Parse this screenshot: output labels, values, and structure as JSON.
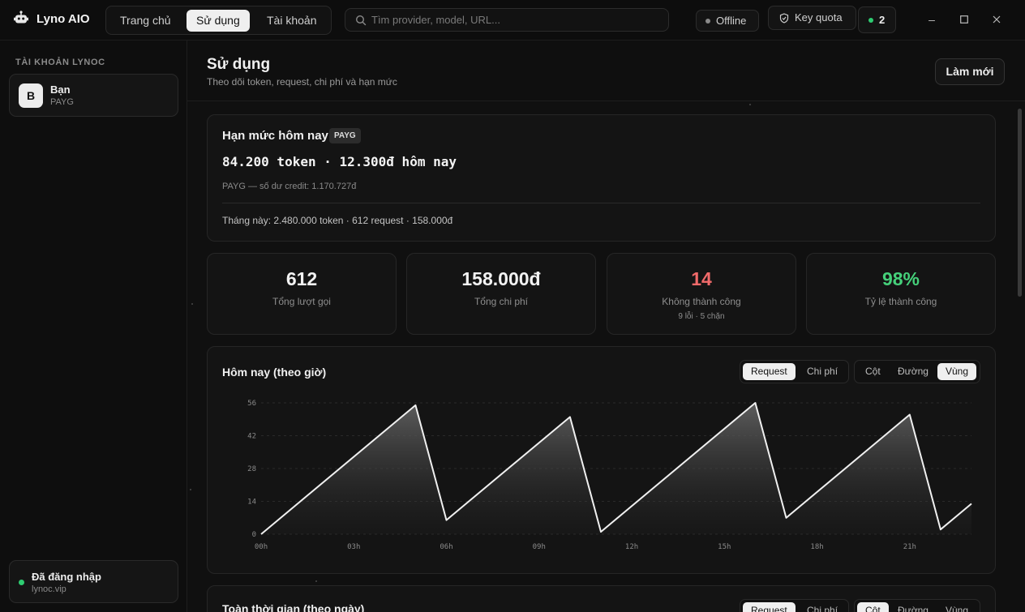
{
  "app": {
    "title": "Lyno AIO"
  },
  "nav": {
    "tabs": [
      {
        "label": "Trang chủ",
        "active": false
      },
      {
        "label": "Sử dụng",
        "active": true
      },
      {
        "label": "Tài khoản",
        "active": false
      }
    ]
  },
  "search": {
    "placeholder": "Tìm provider, model, URL..."
  },
  "header_status": {
    "offline_label": "Offline",
    "key_quota_label": "Key quota",
    "count": "2"
  },
  "colors": {
    "offline_dot": "#8a8a8a",
    "online_dot": "#2ecc71",
    "danger": "#f06a6a",
    "success": "#45d07a"
  },
  "sidebar": {
    "heading": "TÀI KHOẢN LYNOC",
    "account": {
      "avatar": "B",
      "name": "Bạn",
      "plan": "PAYG"
    },
    "login": {
      "title": "Đã đăng nhập",
      "sub": "lynoc.vip"
    }
  },
  "page": {
    "title": "Sử dụng",
    "subtitle": "Theo dõi token, request, chi phí và hạn mức",
    "refresh_label": "Làm mới"
  },
  "quota": {
    "title": "Hạn mức hôm nay",
    "badge": "PAYG",
    "main": "84.200 token · 12.300đ hôm nay",
    "credit": "PAYG — số dư credit: 1.170.727đ",
    "month": "Tháng này: 2.480.000 token · 612 request · 158.000đ"
  },
  "stats": [
    {
      "value": "612",
      "label": "Tổng lượt gọi",
      "sub": ""
    },
    {
      "value": "158.000đ",
      "label": "Tổng chi phí",
      "sub": ""
    },
    {
      "value": "14",
      "label": "Không thành công",
      "sub": "9 lỗi · 5 chặn"
    },
    {
      "value": "98%",
      "label": "Tỷ lệ thành công",
      "sub": ""
    }
  ],
  "today_chart": {
    "title": "Hôm nay (theo giờ)",
    "metric_tabs": [
      {
        "label": "Request",
        "active": true
      },
      {
        "label": "Chi phí",
        "active": false
      }
    ],
    "type_tabs": [
      {
        "label": "Cột",
        "active": false
      },
      {
        "label": "Đường",
        "active": false
      },
      {
        "label": "Vùng",
        "active": true
      }
    ]
  },
  "all_time_chart": {
    "title": "Toàn thời gian (theo ngày)",
    "metric_tabs": [
      {
        "label": "Request",
        "active": true
      },
      {
        "label": "Chi phí",
        "active": false
      }
    ],
    "type_tabs": [
      {
        "label": "Cột",
        "active": true
      },
      {
        "label": "Đường",
        "active": false
      },
      {
        "label": "Vùng",
        "active": false
      }
    ]
  },
  "chart_data": {
    "type": "area",
    "x": [
      0,
      5,
      6,
      10,
      11,
      16,
      17,
      21,
      22,
      23
    ],
    "values": [
      0,
      55,
      6,
      50,
      1,
      56,
      7,
      51,
      2,
      13
    ],
    "xticks": [
      "00h",
      "03h",
      "06h",
      "09h",
      "12h",
      "15h",
      "18h",
      "21h"
    ],
    "xtick_positions": [
      0,
      3,
      6,
      9,
      12,
      15,
      18,
      21
    ],
    "yticks": [
      0,
      14,
      28,
      42,
      56
    ],
    "xlim": [
      0,
      23
    ],
    "ylim": [
      0,
      56
    ],
    "grid": true
  }
}
